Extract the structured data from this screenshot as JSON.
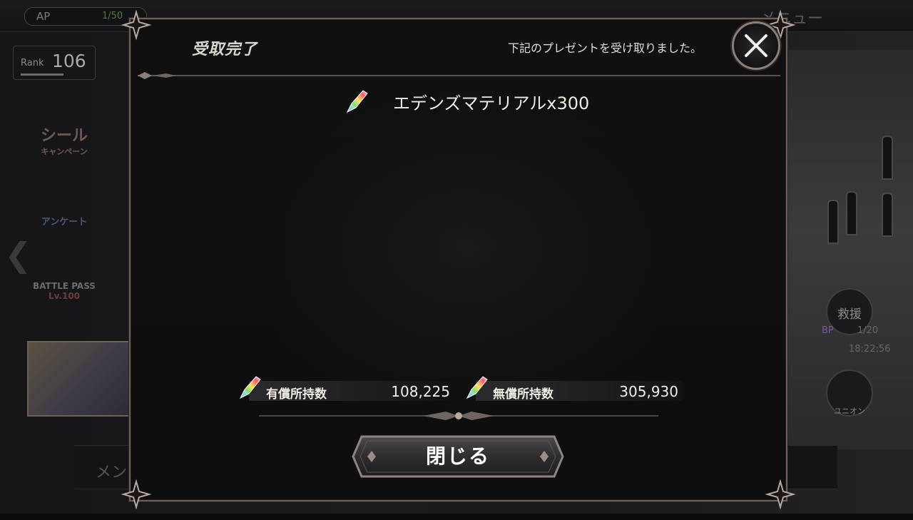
{
  "background": {
    "ap_label": "AP",
    "ap_value": "1/50",
    "menu_label": "メニュー",
    "rank_label": "Rank",
    "rank_value": "106",
    "side_seal": "シール",
    "side_seal_sub": "キャンペーン",
    "side_survey": "アンケート",
    "side_battlepass": "BATTLE PASS",
    "side_battlepass_lv": "Lv.100",
    "rescue_label": "救援",
    "bp_label": "BP",
    "bp_value": "1/20",
    "time": "18:22:56",
    "union_label": "ユニオン",
    "bottom_menu": "メン"
  },
  "dialog": {
    "title": "受取完了",
    "message": "下記のプレゼントを受け取りました。",
    "close_icon": "close-x-icon",
    "item": {
      "icon": "crystal-icon",
      "name": "エデンズマテリアルx300"
    },
    "holdings": [
      {
        "label": "有償所持数",
        "value": "108,225",
        "icon": "crystal-icon"
      },
      {
        "label": "無償所持数",
        "value": "305,930",
        "icon": "crystal-icon"
      }
    ],
    "close_button": "閉じる"
  },
  "colors": {
    "frame": "#6e5f58",
    "panel": "#101010",
    "text": "#efeae2"
  }
}
